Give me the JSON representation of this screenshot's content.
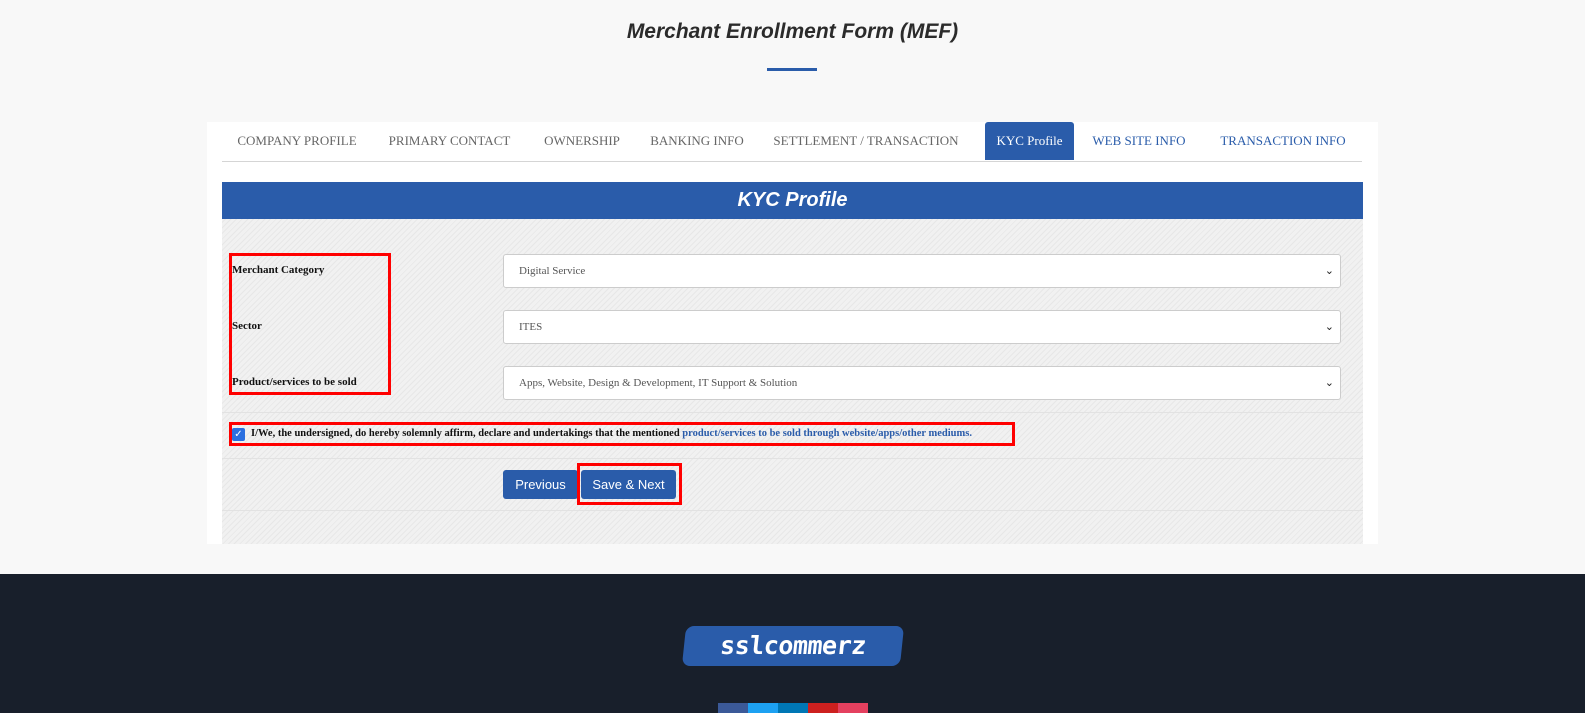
{
  "page": {
    "title": "Merchant Enrollment Form (MEF)"
  },
  "tabs": [
    {
      "label": "COMPANY PROFILE",
      "state": "completed"
    },
    {
      "label": "PRIMARY CONTACT",
      "state": "completed"
    },
    {
      "label": "OWNERSHIP",
      "state": "completed"
    },
    {
      "label": "BANKING INFO",
      "state": "completed"
    },
    {
      "label": "SETTLEMENT / TRANSACTION",
      "state": "completed"
    },
    {
      "label": "KYC Profile",
      "state": "active"
    },
    {
      "label": "WEB SITE INFO",
      "state": "pending"
    },
    {
      "label": "TRANSACTION INFO",
      "state": "pending"
    }
  ],
  "section": {
    "title": "KYC Profile"
  },
  "fields": [
    {
      "label": "Merchant Category",
      "value": "Digital Service"
    },
    {
      "label": "Sector",
      "value": "ITES"
    },
    {
      "label": "Product/services to be sold",
      "value": "Apps, Website, Design & Development, IT Support & Solution"
    }
  ],
  "affirmation": {
    "checked": true,
    "text": "I/We, the undersigned, do hereby solemnly affirm, declare and undertakings that the mentioned",
    "link_text": "product/services to be sold through website/apps/other mediums."
  },
  "buttons": {
    "previous": "Previous",
    "save_next": "Save & Next"
  },
  "footer": {
    "logo_text": "sslcommerz"
  },
  "colors": {
    "primary": "#2a5caa",
    "footer_bg": "#181f2b",
    "highlight": "#ff0000"
  }
}
